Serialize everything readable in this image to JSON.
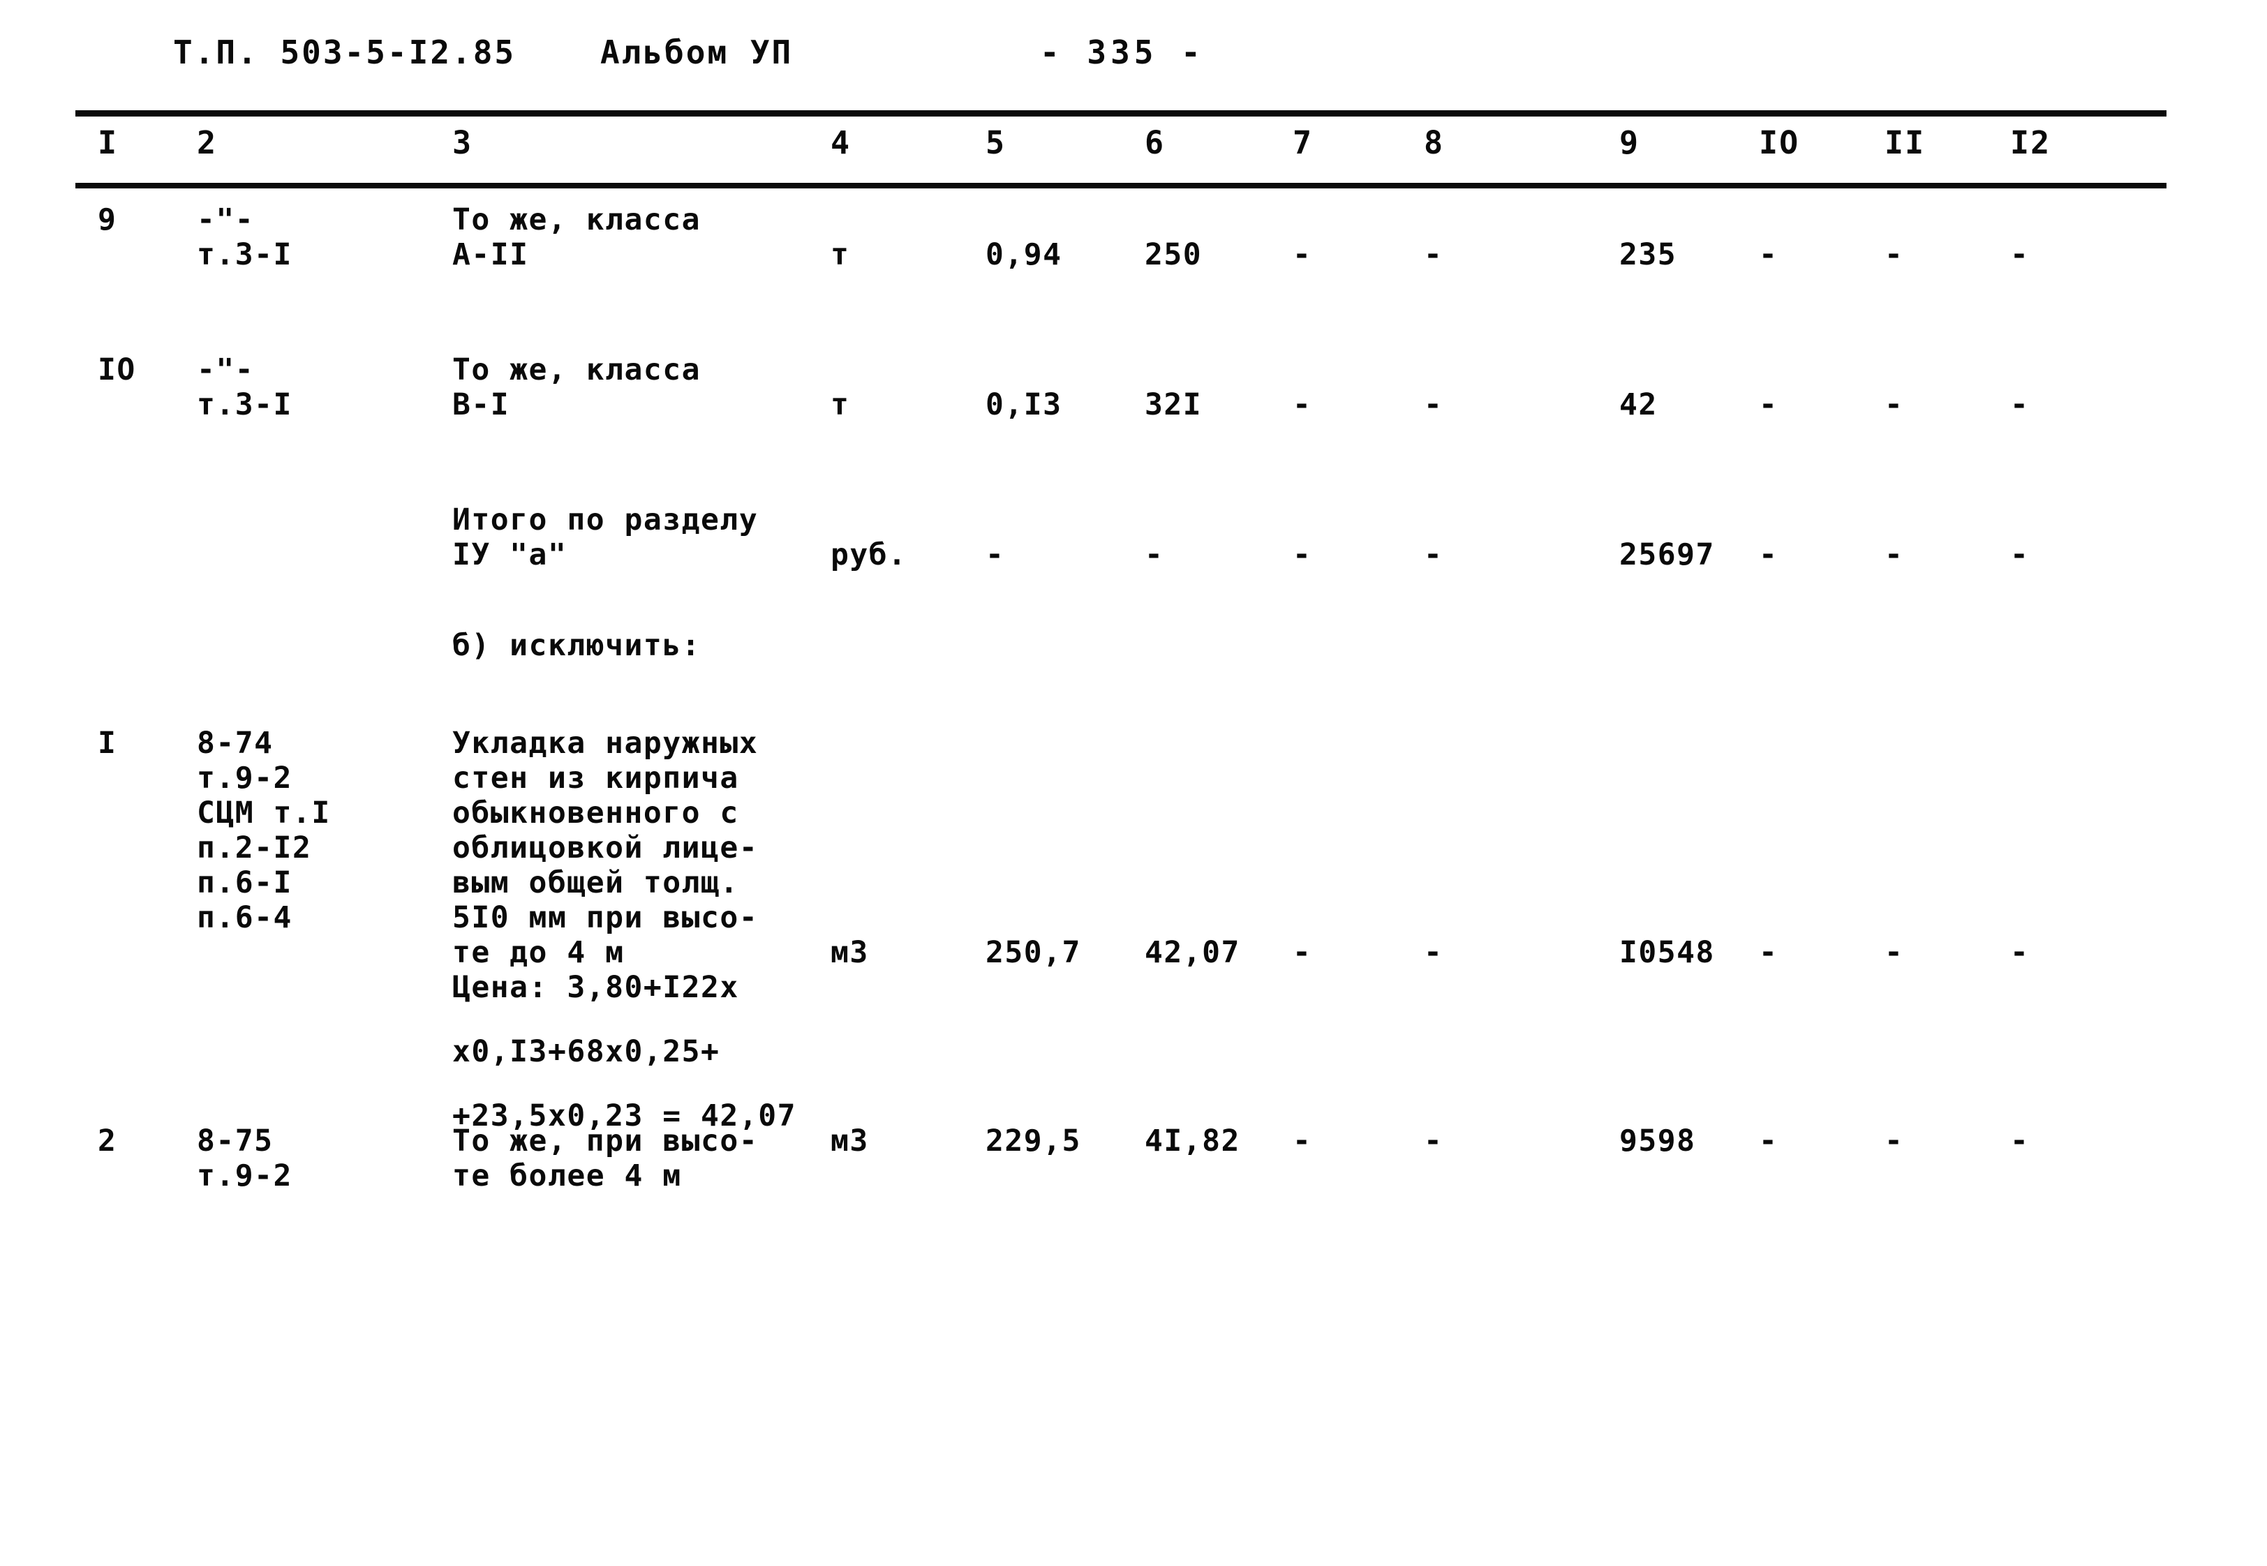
{
  "header": {
    "doc_code": "Т.П. 503-5-I2.85",
    "album": "Альбом УП",
    "page_number": "- 335 -"
  },
  "table": {
    "column_headers": [
      "I",
      "2",
      "3",
      "4",
      "5",
      "6",
      "7",
      "8",
      "9",
      "IO",
      "II",
      "I2"
    ],
    "dash": "-",
    "rows": [
      {
        "id": "row-9",
        "c1": "9",
        "c2_lines": [
          "-\"-",
          "т.3-I"
        ],
        "c3_lines": [
          "То же, класса",
          "А-II"
        ],
        "c4": "т",
        "c5": "0,94",
        "c6": "250",
        "c7": "-",
        "c8": "-",
        "c9": "235",
        "c10": "-",
        "c11": "-",
        "c12": "-"
      },
      {
        "id": "row-10",
        "c1": "IO",
        "c2_lines": [
          "-\"-",
          "т.3-I"
        ],
        "c3_lines": [
          "То же, класса",
          "В-I"
        ],
        "c4": "т",
        "c5": "0,I3",
        "c6": "32I",
        "c7": "-",
        "c8": "-",
        "c9": "42",
        "c10": "-",
        "c11": "-",
        "c12": "-"
      },
      {
        "id": "row-total-4a",
        "c1": "",
        "c2_lines": [],
        "c3_lines": [
          "Итого по разделу",
          "IУ \"а\""
        ],
        "c4": "руб.",
        "c5": "-",
        "c6": "-",
        "c7": "-",
        "c8": "-",
        "c9": "25697",
        "c10": "-",
        "c11": "-",
        "c12": "-"
      },
      {
        "id": "row-subsection-b",
        "c1": "",
        "c2_lines": [],
        "c3_lines": [
          "б) исключить:"
        ],
        "c4": "",
        "c5": "",
        "c6": "",
        "c7": "",
        "c8": "",
        "c9": "",
        "c10": "",
        "c11": "",
        "c12": ""
      },
      {
        "id": "row-1",
        "c1": "I",
        "c2_lines": [
          "8-74",
          "т.9-2",
          "СЦМ т.I",
          "п.2-I2",
          "п.6-I",
          "п.6-4"
        ],
        "c3_lines": [
          "Укладка наружных",
          "стен из кирпича",
          "обыкновенного с",
          "облицовкой лице-",
          "вым общей толщ.",
          "5I0 мм при высо-",
          "те до 4 м"
        ],
        "c4": "м3",
        "c5": "250,7",
        "c6": "42,07",
        "c7": "-",
        "c8": "-",
        "c9": "I0548",
        "c10": "-",
        "c11": "-",
        "c12": "-",
        "price_lines": [
          "Цена: 3,80+I22x",
          "х0,I3+68х0,25+",
          "+23,5х0,23 = 42,07"
        ]
      },
      {
        "id": "row-2",
        "c1": "2",
        "c2_lines": [
          "8-75",
          "т.9-2"
        ],
        "c3_lines": [
          "То же, при высо-",
          "те более 4 м"
        ],
        "c4": "м3",
        "c5": "229,5",
        "c6": "4I,82",
        "c7": "-",
        "c8": "-",
        "c9": "9598",
        "c10": "-",
        "c11": "-",
        "c12": "-"
      }
    ]
  }
}
